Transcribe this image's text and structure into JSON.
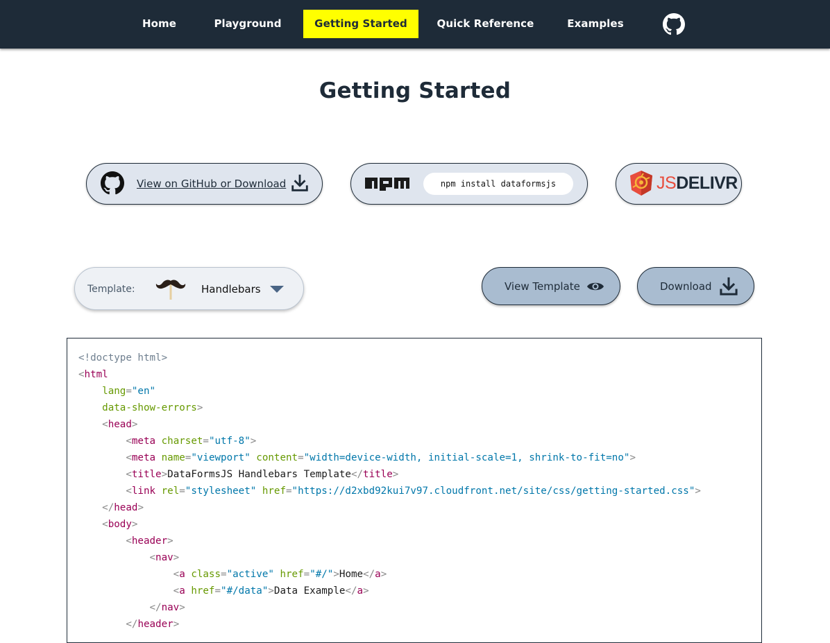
{
  "nav": {
    "items": [
      {
        "label": "Home"
      },
      {
        "label": "Playground"
      },
      {
        "label": "Getting Started",
        "active": true
      },
      {
        "label": "Quick Reference"
      },
      {
        "label": "Examples"
      }
    ],
    "github_icon": "github-icon",
    "active_color": "#ffff00",
    "bg_color": "#1e2b38"
  },
  "page": {
    "title": "Getting Started"
  },
  "links": {
    "github_text": "View on GitHub or Download",
    "npm_command": "npm install dataformsjs",
    "npm_logo": "npm",
    "jsdelivr_js": "JS",
    "jsdelivr_delivr": "DELIVR"
  },
  "template_select": {
    "label": "Template:",
    "value": "Handlebars",
    "icon": "mustache-icon"
  },
  "actions": {
    "view_template": "View Template",
    "download": "Download"
  },
  "code": {
    "lines": [
      [
        [
          "d",
          "<!doctype html>"
        ]
      ],
      [
        [
          "p",
          "<"
        ],
        [
          "t",
          "html"
        ]
      ],
      [
        [
          "",
          "    "
        ],
        [
          "a",
          "lang"
        ],
        [
          "p",
          "="
        ],
        [
          "v",
          "\"en\""
        ]
      ],
      [
        [
          "",
          "    "
        ],
        [
          "a",
          "data-show-errors"
        ],
        [
          "p",
          ">"
        ]
      ],
      [
        [
          "",
          "    "
        ],
        [
          "p",
          "<"
        ],
        [
          "t",
          "head"
        ],
        [
          "p",
          ">"
        ]
      ],
      [
        [
          "",
          "        "
        ],
        [
          "p",
          "<"
        ],
        [
          "t",
          "meta"
        ],
        [
          "",
          " "
        ],
        [
          "a",
          "charset"
        ],
        [
          "p",
          "="
        ],
        [
          "v",
          "\"utf-8\""
        ],
        [
          "p",
          ">"
        ]
      ],
      [
        [
          "",
          "        "
        ],
        [
          "p",
          "<"
        ],
        [
          "t",
          "meta"
        ],
        [
          "",
          " "
        ],
        [
          "a",
          "name"
        ],
        [
          "p",
          "="
        ],
        [
          "v",
          "\"viewport\""
        ],
        [
          "",
          " "
        ],
        [
          "a",
          "content"
        ],
        [
          "p",
          "="
        ],
        [
          "v",
          "\"width=device-width, initial-scale=1, shrink-to-fit=no\""
        ],
        [
          "p",
          ">"
        ]
      ],
      [
        [
          "",
          "        "
        ],
        [
          "p",
          "<"
        ],
        [
          "t",
          "title"
        ],
        [
          "p",
          ">"
        ],
        [
          "",
          "DataFormsJS Handlebars Template"
        ],
        [
          "p",
          "</"
        ],
        [
          "t",
          "title"
        ],
        [
          "p",
          ">"
        ]
      ],
      [
        [
          "",
          "        "
        ],
        [
          "p",
          "<"
        ],
        [
          "t",
          "link"
        ],
        [
          "",
          " "
        ],
        [
          "a",
          "rel"
        ],
        [
          "p",
          "="
        ],
        [
          "v",
          "\"stylesheet\""
        ],
        [
          "",
          " "
        ],
        [
          "a",
          "href"
        ],
        [
          "p",
          "="
        ],
        [
          "v",
          "\"https://d2xbd92kui7v97.cloudfront.net/site/css/getting-started.css\""
        ],
        [
          "p",
          ">"
        ]
      ],
      [
        [
          "",
          "    "
        ],
        [
          "p",
          "</"
        ],
        [
          "t",
          "head"
        ],
        [
          "p",
          ">"
        ]
      ],
      [
        [
          "",
          "    "
        ],
        [
          "p",
          "<"
        ],
        [
          "t",
          "body"
        ],
        [
          "p",
          ">"
        ]
      ],
      [
        [
          "",
          "        "
        ],
        [
          "p",
          "<"
        ],
        [
          "t",
          "header"
        ],
        [
          "p",
          ">"
        ]
      ],
      [
        [
          "",
          "            "
        ],
        [
          "p",
          "<"
        ],
        [
          "t",
          "nav"
        ],
        [
          "p",
          ">"
        ]
      ],
      [
        [
          "",
          "                "
        ],
        [
          "p",
          "<"
        ],
        [
          "t",
          "a"
        ],
        [
          "",
          " "
        ],
        [
          "a",
          "class"
        ],
        [
          "p",
          "="
        ],
        [
          "v",
          "\"active\""
        ],
        [
          "",
          " "
        ],
        [
          "a",
          "href"
        ],
        [
          "p",
          "="
        ],
        [
          "v",
          "\"#/\""
        ],
        [
          "p",
          ">"
        ],
        [
          "",
          "Home"
        ],
        [
          "p",
          "</"
        ],
        [
          "t",
          "a"
        ],
        [
          "p",
          ">"
        ]
      ],
      [
        [
          "",
          "                "
        ],
        [
          "p",
          "<"
        ],
        [
          "t",
          "a"
        ],
        [
          "",
          " "
        ],
        [
          "a",
          "href"
        ],
        [
          "p",
          "="
        ],
        [
          "v",
          "\"#/data\""
        ],
        [
          "p",
          ">"
        ],
        [
          "",
          "Data Example"
        ],
        [
          "p",
          "</"
        ],
        [
          "t",
          "a"
        ],
        [
          "p",
          ">"
        ]
      ],
      [
        [
          "",
          "            "
        ],
        [
          "p",
          "</"
        ],
        [
          "t",
          "nav"
        ],
        [
          "p",
          ">"
        ]
      ],
      [
        [
          "",
          "        "
        ],
        [
          "p",
          "</"
        ],
        [
          "t",
          "header"
        ],
        [
          "p",
          ">"
        ]
      ]
    ]
  }
}
